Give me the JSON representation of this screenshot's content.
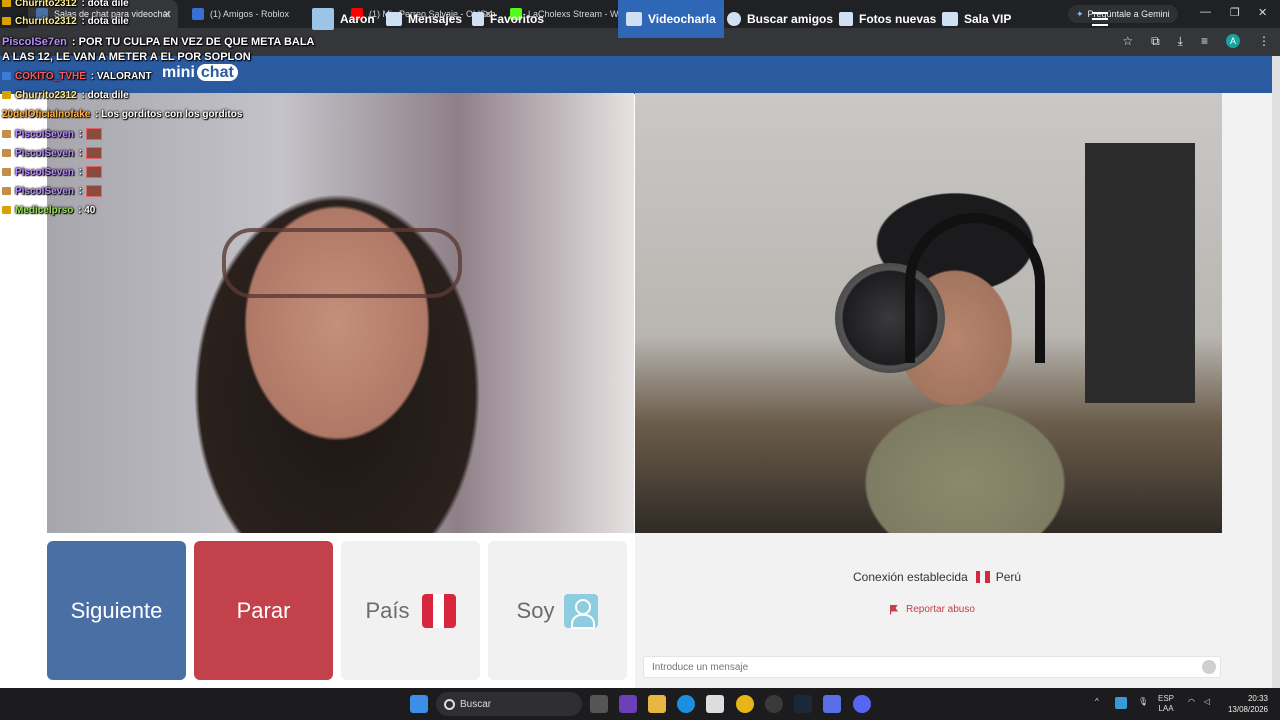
{
  "browser": {
    "tabs": [
      {
        "label": "Salas de chat para videochat",
        "active": true,
        "favicon_color": "#4a6fa5"
      },
      {
        "label": "(1) Amigos - Roblox",
        "active": false,
        "favicon_color": "#3a6fd8"
      },
      {
        "label": "(1) Mix Perreo Salvaje - OldSch",
        "active": false,
        "favicon_color": "#ff0000"
      },
      {
        "label": "LaCholexs Stream - Watch Live",
        "active": false,
        "favicon_color": "#53fc18"
      }
    ],
    "gemini_button": "Pregúntale a Gemini",
    "profile_initial": "A"
  },
  "chat_overlay": [
    {
      "user": "Churrito2312",
      "text": "dota dile"
    },
    {
      "user": "Churrito2312",
      "text": "dota dile"
    },
    {
      "user": "PiscoISe7en",
      "text": "POR TU CULPA EN VEZ DE QUE META BALA"
    },
    {
      "user": "",
      "text": "A LAS 12, LE VAN A METER A EL POR SOPLON"
    },
    {
      "user": "COKITO_TVHE",
      "text": "VALORANT"
    },
    {
      "user": "Churrito2312",
      "text": "dota dile"
    },
    {
      "user": "20delOficialnofake",
      "text": "Los gorditos con los gorditos"
    },
    {
      "user": "PiscoISeven",
      "text": ""
    },
    {
      "user": "PiscoISeven",
      "text": ""
    },
    {
      "user": "PiscoISeven",
      "text": ""
    },
    {
      "user": "PiscoISeven",
      "text": ""
    },
    {
      "user": "Medicelprso",
      "text": "40"
    }
  ],
  "site": {
    "logo_text_1": "mini",
    "logo_text_2": "chat",
    "nav": [
      {
        "label": "Aaron"
      },
      {
        "label": "Mensajes"
      },
      {
        "label": "Favoritos"
      },
      {
        "label": "Videocharla"
      },
      {
        "label": "Buscar amigos"
      },
      {
        "label": "Fotos nuevas"
      },
      {
        "label": "Sala VIP"
      }
    ]
  },
  "controls": {
    "next": "Siguiente",
    "stop": "Parar",
    "country": "País",
    "gender": "Soy"
  },
  "chat_panel": {
    "connection_text": "Conexión establecida",
    "country": "Perú",
    "report": "Reportar abuso",
    "input_placeholder": "Introduce un mensaje"
  },
  "taskbar": {
    "search": "Buscar",
    "lang_1": "ESP",
    "lang_2": "LAA",
    "time": "20:33",
    "date": "13/08/2026"
  }
}
